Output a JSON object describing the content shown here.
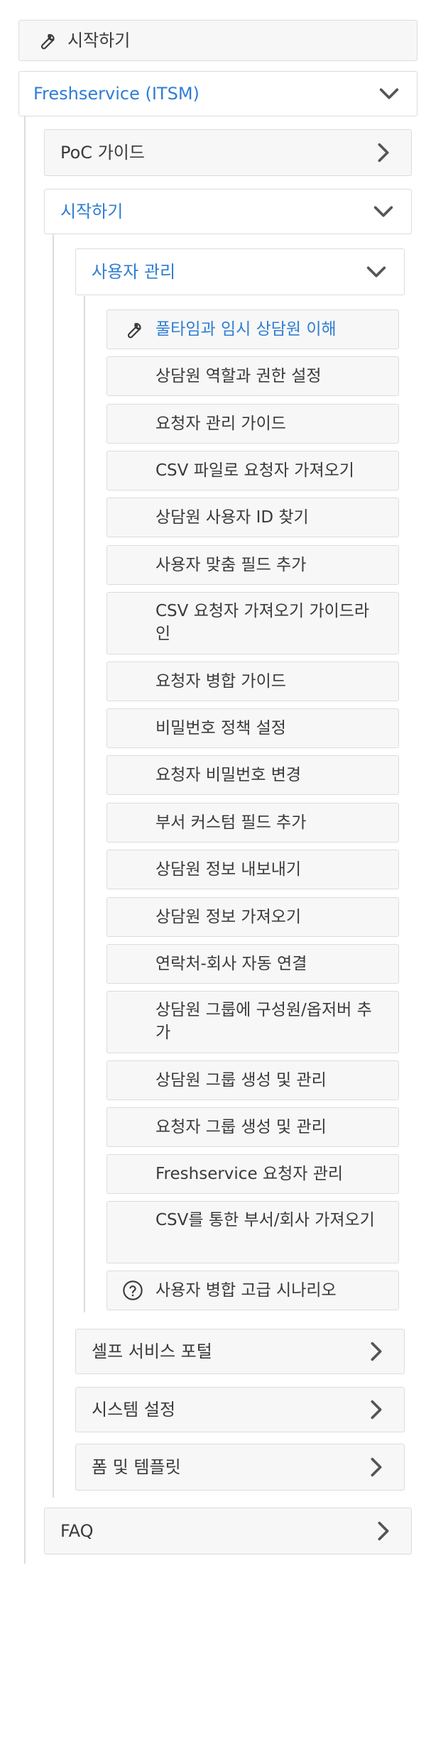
{
  "top": {
    "label": "시작하기",
    "icon": "wrench-icon"
  },
  "section": {
    "label": "Freshservice (ITSM)",
    "expanded": true
  },
  "poc": {
    "label": "PoC 가이드"
  },
  "start": {
    "label": "시작하기",
    "expanded": true
  },
  "user_mgmt": {
    "label": "사용자 관리",
    "expanded": true
  },
  "leaves": [
    "풀타임과 임시 상담원 이해",
    "상담원 역할과 권한 설정",
    "요청자 관리 가이드",
    "CSV 파일로 요청자 가져오기",
    "상담원 사용자 ID 찾기",
    "사용자 맞춤 필드 추가",
    "CSV 요청자 가져오기 가이드라인",
    "요청자 병합 가이드",
    "비밀번호 정책 설정",
    "요청자 비밀번호 변경",
    "부서 커스텀 필드 추가",
    "상담원 정보 내보내기",
    "상담원 정보 가져오기",
    "연락처-회사 자동 연결",
    "상담원 그룹에 구성원/옵저버 추가",
    "상담원 그룹 생성 및 관리",
    "요청자 그룹 생성 및 관리",
    "Freshservice 요청자 관리",
    "CSV를 통한 부서/회사 가져오기",
    "사용자 병합 고급 시나리오"
  ],
  "active_leaf_icon": "wrench-icon",
  "last_leaf_icon": "question-circle-icon",
  "siblings": [
    {
      "label": "셀프 서비스 포털"
    },
    {
      "label": "시스템 설정"
    },
    {
      "label": "폼 및 템플릿"
    }
  ],
  "faq": {
    "label": "FAQ"
  },
  "colors": {
    "accent": "#2f7dd3",
    "border": "#dcdcdc",
    "bg": "#f7f7f7"
  }
}
